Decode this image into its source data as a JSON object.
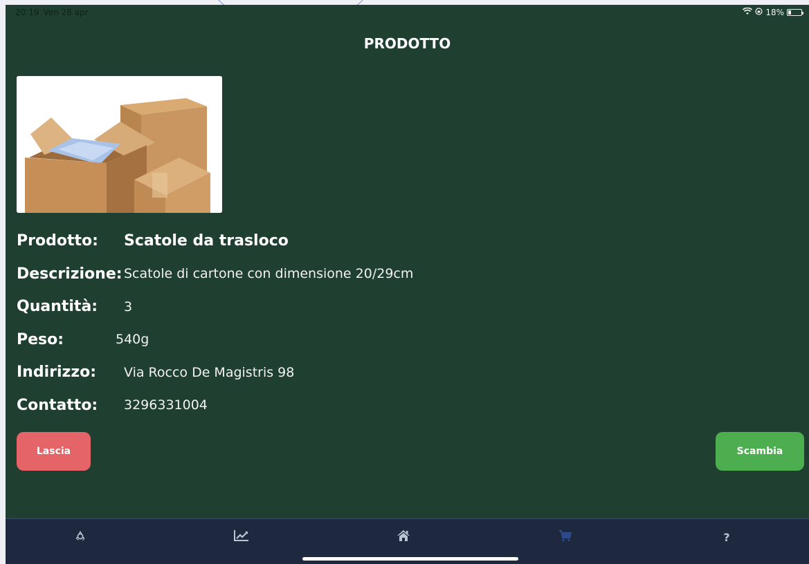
{
  "status": {
    "time": "20:19",
    "date": "Ven 28 apr",
    "battery": "18%"
  },
  "header": {
    "title": "PRODOTTO"
  },
  "product": {
    "image_alt": "cardboard-boxes",
    "rows": [
      {
        "label": "Prodotto:",
        "value": "Scatole da trasloco"
      },
      {
        "label": "Descrizione:",
        "value": "Scatole di cartone con dimensione 20/29cm"
      },
      {
        "label": "Quantità:",
        "value": "3"
      },
      {
        "label": "Peso:",
        "value": "540g"
      },
      {
        "label": "Indirizzo:",
        "value": "Via Rocco De Magistris 98"
      },
      {
        "label": "Contatto:",
        "value": "3296331004"
      }
    ]
  },
  "actions": {
    "leave_label": "Lascia",
    "swap_label": "Scambia"
  },
  "tabbar": {
    "items": [
      {
        "icon": "recycle-icon"
      },
      {
        "icon": "chart-icon"
      },
      {
        "icon": "home-icon"
      },
      {
        "icon": "cart-icon"
      },
      {
        "icon": "help-icon",
        "label": "?"
      }
    ]
  },
  "colors": {
    "background": "#1f3f30",
    "tabbar": "#1e2940",
    "leave": "#e46468",
    "swap": "#4dae50"
  }
}
